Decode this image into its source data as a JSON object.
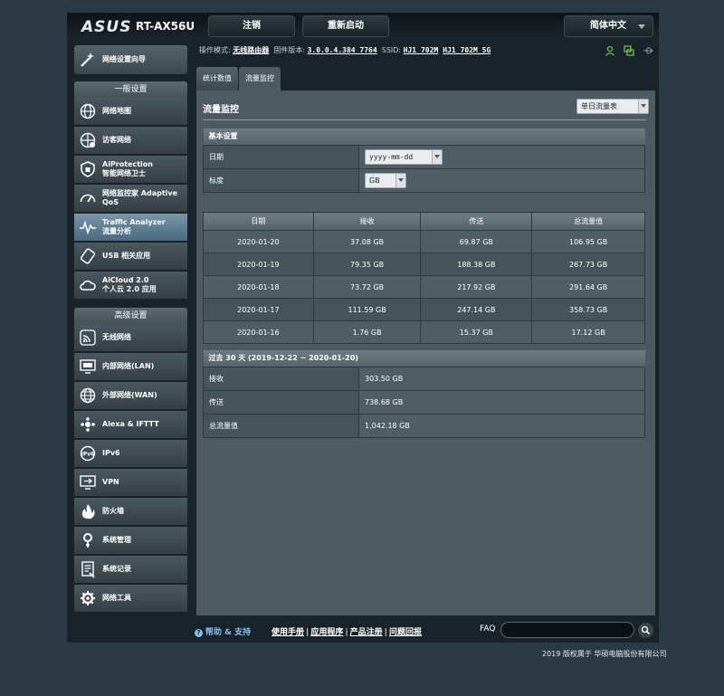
{
  "header": {
    "logo": "ASUS",
    "model": "RT-AX56U",
    "logout": "注销",
    "reboot": "重新启动",
    "language": "简体中文"
  },
  "status": {
    "mode_label": "操作模式:",
    "mode_value": "无线路由器",
    "fw_label": "固件版本:",
    "fw_value": "3.0.0.4.384_7764",
    "ssid_label": "SSID:",
    "ssid1": "HJ1_702M",
    "ssid2": "HJ1_702M_5G"
  },
  "sidebar": {
    "quick_setup": "网络设置向导",
    "general_title": "一般设置",
    "general_items": [
      {
        "label": "网络地图"
      },
      {
        "label": "访客网络"
      },
      {
        "label": "AiProtection\n智能网络卫士"
      },
      {
        "label": "网络监控家 Adaptive\nQoS"
      },
      {
        "label": "Traffic Analyzer\n流量分析"
      },
      {
        "label": "USB 相关应用"
      },
      {
        "label": "AiCloud 2.0\n个人云 2.0 应用"
      }
    ],
    "advanced_title": "高级设置",
    "advanced_items": [
      {
        "label": "无线网络"
      },
      {
        "label": "内部网络(LAN)"
      },
      {
        "label": "外部网络(WAN)"
      },
      {
        "label": "Alexa & IFTTT"
      },
      {
        "label": "IPv6"
      },
      {
        "label": "VPN"
      },
      {
        "label": "防火墙"
      },
      {
        "label": "系统管理"
      },
      {
        "label": "系统记录"
      },
      {
        "label": "网络工具"
      }
    ]
  },
  "tabs": [
    {
      "label": "统计数值"
    },
    {
      "label": "流量监控"
    }
  ],
  "main": {
    "title": "流量监控",
    "view_select": "单日流量表",
    "basic": {
      "title": "基本设置",
      "date_label": "日期",
      "date_value": "yyyy-mm-dd",
      "unit_label": "标度",
      "unit_value": "GB"
    },
    "table": {
      "headers": [
        "日期",
        "接收",
        "传送",
        "总流量值"
      ],
      "rows": [
        [
          "2020-01-20",
          "37.08 GB",
          "69.87 GB",
          "106.95 GB"
        ],
        [
          "2020-01-19",
          "79.35 GB",
          "188.38 GB",
          "267.73 GB"
        ],
        [
          "2020-01-18",
          "73.72 GB",
          "217.92 GB",
          "291.64 GB"
        ],
        [
          "2020-01-17",
          "111.59 GB",
          "247.14 GB",
          "358.73 GB"
        ],
        [
          "2020-01-16",
          "1.76 GB",
          "15.37 GB",
          "17.12 GB"
        ]
      ]
    },
    "summary": {
      "title": "过去 30 天 (2019-12-22 ~ 2020-01-20)",
      "rows": [
        {
          "label": "接收",
          "value": "303.50 GB"
        },
        {
          "label": "传送",
          "value": "738.68 GB"
        },
        {
          "label": "总流量值",
          "value": "1,042.18 GB"
        }
      ]
    }
  },
  "footer": {
    "help": "帮助 & 支持",
    "links": [
      "使用手册",
      "应用程序",
      "产品注册",
      "问题回报"
    ],
    "faq": "FAQ",
    "copyright": "2019 版权属于 华硕电脑股份有限公司"
  },
  "colors": {
    "accent": "#7fc0ee",
    "status_green": "#67c24e",
    "active_menu": "#5c7c92"
  }
}
